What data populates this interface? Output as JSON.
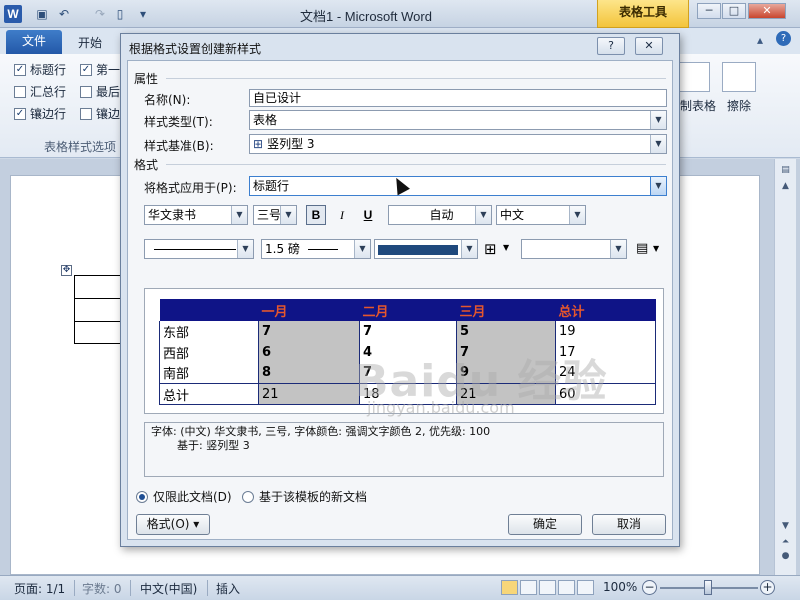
{
  "app": {
    "logo": "W",
    "window_title": "文档1 - Microsoft Word",
    "context_tab": "表格工具",
    "window_controls": {
      "minimize": "─",
      "maximize": "□",
      "close": "✕"
    }
  },
  "ribbon": {
    "tabs": {
      "file": "文件",
      "home": "开始"
    },
    "table_style_options": [
      {
        "label": "标题行",
        "checked": true
      },
      {
        "label": "第一",
        "checked": true
      },
      {
        "label": "汇总行",
        "checked": false
      },
      {
        "label": "最后",
        "checked": false
      },
      {
        "label": "镶边行",
        "checked": true
      },
      {
        "label": "镶边",
        "checked": false
      }
    ],
    "group_label": "表格样式选项",
    "draw_table_label": "制表格",
    "eraser_label": "擦除"
  },
  "dialog": {
    "title": "根据格式设置创建新样式",
    "help_button": "?",
    "close_button": "✕",
    "properties_section": "属性",
    "name_label": "名称(N):",
    "name_value": "自已设计",
    "style_type_label": "样式类型(T):",
    "style_type_value": "表格",
    "style_based_on_label": "样式基准(B):",
    "style_based_on_value": "竖列型 3",
    "format_section": "格式",
    "apply_to_label": "将格式应用于(P):",
    "apply_to_value": "标题行",
    "font_name": "华文隶书",
    "font_size": "三号",
    "bold_label": "B",
    "italic_label": "I",
    "underline_label": "U",
    "font_color": "自动",
    "script": "中文",
    "border_weight": "1.5 磅",
    "preview": {
      "headers": [
        "",
        "一月",
        "二月",
        "三月",
        "总计"
      ],
      "rows": [
        [
          "东部",
          "7",
          "7",
          "5",
          "19"
        ],
        [
          "西部",
          "6",
          "4",
          "7",
          "17"
        ],
        [
          "南部",
          "8",
          "7",
          "9",
          "24"
        ]
      ],
      "total_row": [
        "总计",
        "21",
        "18",
        "21",
        "60"
      ],
      "header_bg": "#0f1487",
      "header_text": "#e5572d"
    },
    "description_line1": "字体: (中文) 华文隶书, 三号, 字体颜色: 强调文字颜色 2, 优先级: 100",
    "description_line2": "基于: 竖列型 3",
    "radio_this_document": "仅限此文档(D)",
    "radio_new_documents": "基于该模板的新文档",
    "format_button": "格式(O) ▾",
    "ok_button": "确定",
    "cancel_button": "取消"
  },
  "statusbar": {
    "page": "页面: 1/1",
    "word_count": "字数: 0",
    "language": "中文(中国)",
    "insert_mode": "插入",
    "zoom": "100%",
    "zoom_level": 1.0
  },
  "watermark": {
    "text": "Baidu 经验",
    "url": "jingyan.baidu.com"
  }
}
